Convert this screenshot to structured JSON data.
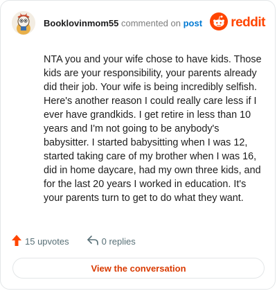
{
  "header": {
    "author": "Booklovinmom55",
    "action_text": "commented on",
    "post_link": "post",
    "brand": "reddit"
  },
  "comment": {
    "text": "NTA you and your wife chose to have kids. Those kids are your responsibility, your parents already did their job. Your wife is being incredibly selfish. Here's another reason I could really care less if I ever have grandkids. I get retire in less than 10 years and I'm not going to be anybody's babysitter. I started babysitting when I was 12, started taking care of my brother when I was 16, did in home daycare, had my own three kids, and for the last 20 years I worked in education. It's your parents turn to get to do what they want."
  },
  "footer": {
    "upvotes": "15 upvotes",
    "replies": "0 replies",
    "view_button": "View the conversation"
  },
  "colors": {
    "brand": "#ff4500",
    "link": "#0079d3",
    "button_text": "#d93a00"
  },
  "icons": {
    "upvote": "upvote-arrow-icon",
    "reply": "reply-arrow-icon",
    "brand": "reddit-alien-icon"
  }
}
